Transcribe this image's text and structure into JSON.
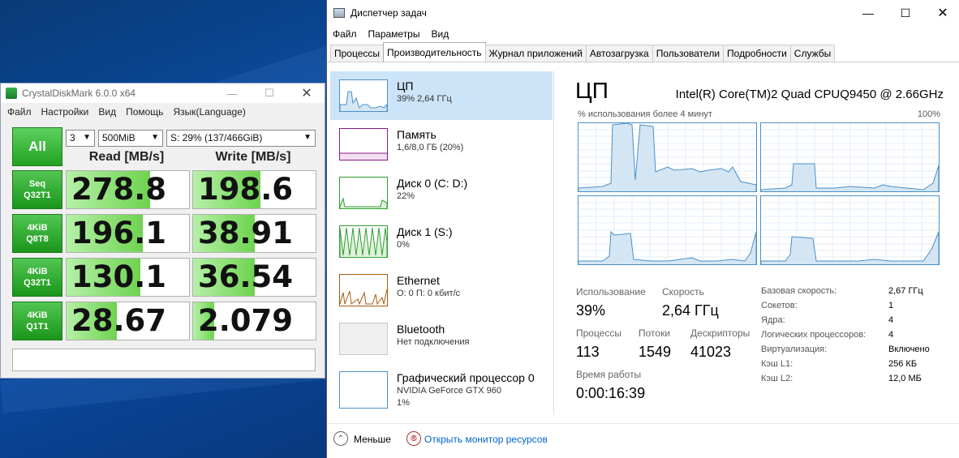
{
  "colors": {
    "accent": "#0066cc",
    "cdm_green": "#21a321",
    "cpu_line": "#4a90c8",
    "memory": "#8b1a8b",
    "disk": "#2f9f2f",
    "ethernet": "#a85a10"
  },
  "cdm": {
    "title": "CrystalDiskMark 6.0.0 x64",
    "menu": [
      "Файл",
      "Настройки",
      "Вид",
      "Помощь",
      "Язык(Language)"
    ],
    "all_label": "All",
    "count": "3",
    "size": "500MiB",
    "drive": "S: 29% (137/466GiB)",
    "read_header": "Read [MB/s]",
    "write_header": "Write [MB/s]",
    "rows": [
      {
        "label1": "Seq",
        "label2": "Q32T1",
        "read": "278.8",
        "write": "198.6",
        "read_fill": 0.68,
        "write_fill": 0.55
      },
      {
        "label1": "4KiB",
        "label2": "Q8T8",
        "read": "196.1",
        "write": "38.91",
        "read_fill": 0.62,
        "write_fill": 0.5
      },
      {
        "label1": "4KiB",
        "label2": "Q32T1",
        "read": "130.1",
        "write": "36.54",
        "read_fill": 0.6,
        "write_fill": 0.5
      },
      {
        "label1": "4KiB",
        "label2": "Q1T1",
        "read": "28.67",
        "write": "2.079",
        "read_fill": 0.41,
        "write_fill": 0.17
      }
    ]
  },
  "tm": {
    "title": "Диспетчер задач",
    "menu": [
      "Файл",
      "Параметры",
      "Вид"
    ],
    "tabs": [
      "Процессы",
      "Производительность",
      "Журнал приложений",
      "Автозагрузка",
      "Пользователи",
      "Подробности",
      "Службы"
    ],
    "active_tab": 1,
    "sidebar": [
      {
        "name": "ЦП",
        "sub": "39%  2,64 ГГц",
        "sub2": ""
      },
      {
        "name": "Память",
        "sub": "1,6/8,0 ГБ (20%)",
        "sub2": ""
      },
      {
        "name": "Диск 0 (C: D:)",
        "sub": "22%",
        "sub2": ""
      },
      {
        "name": "Диск 1 (S:)",
        "sub": "0%",
        "sub2": ""
      },
      {
        "name": "Ethernet",
        "sub": "О: 0 П: 0 кбит/с",
        "sub2": ""
      },
      {
        "name": "Bluetooth",
        "sub": "Нет подключения",
        "sub2": ""
      },
      {
        "name": "Графический процессор 0",
        "sub": "NVIDIA GeForce GTX 960",
        "sub2": "1%"
      }
    ],
    "main": {
      "title": "ЦП",
      "cpu_name": "Intel(R) Core(TM)2 Quad CPUQ9450 @ 2.66GHz",
      "graph_label": "% использования более 4 минут",
      "graph_max": "100%",
      "usage_label": "Использование",
      "usage_value": "39%",
      "speed_label": "Скорость",
      "speed_value": "2,64 ГГц",
      "proc_label": "Процессы",
      "proc_value": "113",
      "threads_label": "Потоки",
      "threads_value": "1549",
      "handles_label": "Дескрипторы",
      "handles_value": "41023",
      "uptime_label": "Время работы",
      "uptime_value": "0:00:16:39",
      "specs": [
        {
          "k": "Базовая скорость:",
          "v": "2,67 ГГц"
        },
        {
          "k": "Сокетов:",
          "v": "1"
        },
        {
          "k": "Ядра:",
          "v": "4"
        },
        {
          "k": "Логических процессоров:",
          "v": "4"
        },
        {
          "k": "Виртуализация:",
          "v": "Включено"
        },
        {
          "k": "Кэш L1:",
          "v": "256 КБ"
        },
        {
          "k": "Кэш L2:",
          "v": "12,0 МБ"
        }
      ]
    },
    "footer": {
      "less": "Меньше",
      "monitor": "Открыть монитор ресурсов"
    }
  }
}
